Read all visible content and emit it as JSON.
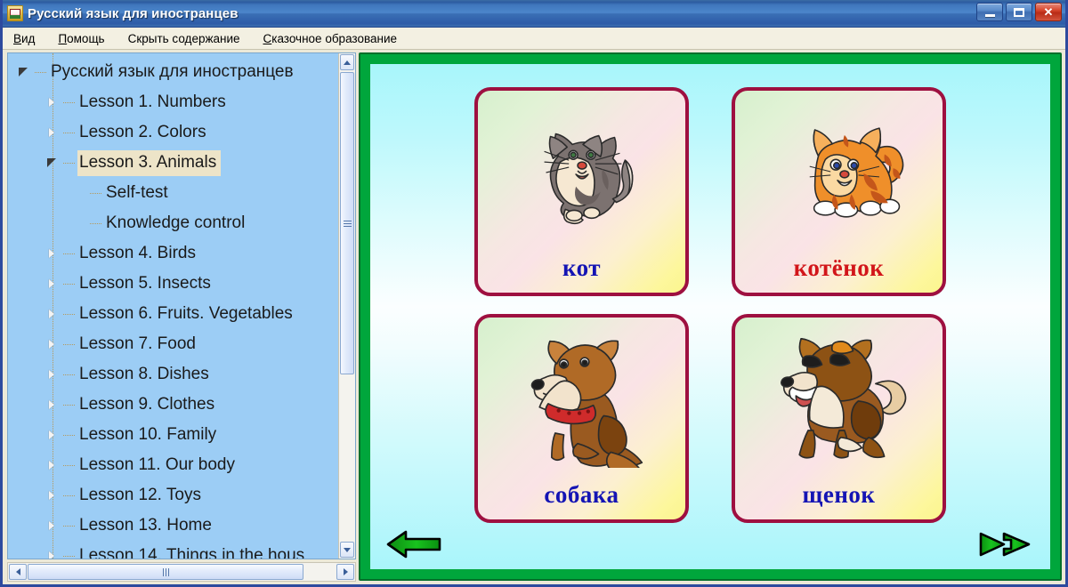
{
  "window": {
    "title": "Русский язык для иностранцев",
    "app_icon": "book-icon",
    "caption": {
      "minimize": "minimize-icon",
      "maximize": "maximize-icon",
      "close_label": "✕"
    }
  },
  "menubar": {
    "items": [
      {
        "name": "menu-vid",
        "pre": "",
        "key": "В",
        "post": "ид"
      },
      {
        "name": "menu-pomosch",
        "pre": "",
        "key": "П",
        "post": "омощь"
      },
      {
        "name": "menu-hide-contents",
        "pre": "Скрыть со",
        "key": "д",
        "post": "ержание"
      },
      {
        "name": "menu-fairytale-education",
        "pre": "",
        "key": "С",
        "post": "казочное образование"
      }
    ]
  },
  "tree": {
    "items": [
      {
        "label": "Русский язык для иностранцев",
        "level": 0,
        "state": "expanded",
        "selected": false
      },
      {
        "label": "Lesson 1. Numbers",
        "level": 1,
        "state": "collapsed",
        "selected": false
      },
      {
        "label": "Lesson 2. Colors",
        "level": 1,
        "state": "collapsed",
        "selected": false
      },
      {
        "label": "Lesson 3. Animals",
        "level": 1,
        "state": "expanded",
        "selected": true
      },
      {
        "label": "Self-test",
        "level": 2,
        "state": "leaf",
        "selected": false
      },
      {
        "label": "Knowledge control",
        "level": 2,
        "state": "leaf",
        "selected": false
      },
      {
        "label": "Lesson 4. Birds",
        "level": 1,
        "state": "collapsed",
        "selected": false
      },
      {
        "label": "Lesson 5. Insects",
        "level": 1,
        "state": "collapsed",
        "selected": false
      },
      {
        "label": "Lesson 6. Fruits. Vegetables",
        "level": 1,
        "state": "collapsed",
        "selected": false
      },
      {
        "label": "Lesson 7. Food",
        "level": 1,
        "state": "collapsed",
        "selected": false
      },
      {
        "label": "Lesson 8. Dishes",
        "level": 1,
        "state": "collapsed",
        "selected": false
      },
      {
        "label": "Lesson 9. Clothes",
        "level": 1,
        "state": "collapsed",
        "selected": false
      },
      {
        "label": "Lesson 10. Family",
        "level": 1,
        "state": "collapsed",
        "selected": false
      },
      {
        "label": "Lesson 11. Our body",
        "level": 1,
        "state": "collapsed",
        "selected": false
      },
      {
        "label": "Lesson 12. Toys",
        "level": 1,
        "state": "collapsed",
        "selected": false
      },
      {
        "label": "Lesson 13. Home",
        "level": 1,
        "state": "collapsed",
        "selected": false
      },
      {
        "label": "Lesson 14. Things in the hous",
        "level": 1,
        "state": "collapsed",
        "selected": false
      }
    ],
    "vscroll": {
      "up_icon": "scroll-up-icon",
      "down_icon": "scroll-down-icon",
      "grip_icon": "thumb-grip-icon"
    },
    "hscroll": {
      "left_icon": "scroll-left-icon",
      "right_icon": "scroll-right-icon",
      "grip_icon": "thumb-grip-icon"
    }
  },
  "content": {
    "cards": [
      {
        "word": "кот",
        "color_class": "blue",
        "art": "cat-illustration"
      },
      {
        "word": "котёнок",
        "color_class": "red",
        "art": "kitten-illustration"
      },
      {
        "word": "собака",
        "color_class": "blue",
        "art": "dog-illustration"
      },
      {
        "word": "щенок",
        "color_class": "blue",
        "art": "puppy-illustration"
      }
    ],
    "nav": {
      "prev_icon": "arrow-left-icon",
      "next_icon": "arrow-right-double-icon"
    },
    "colors": {
      "frame_green": "#00a63c",
      "frame_green_dark": "#046f2a",
      "stage_cyan": "#a8f6fb",
      "card_border": "#9e1040",
      "word_blue": "#1414b4",
      "word_red": "#d2161a",
      "selection_highlight": "#ede4c8",
      "tree_background": "#9ccdf5"
    }
  }
}
